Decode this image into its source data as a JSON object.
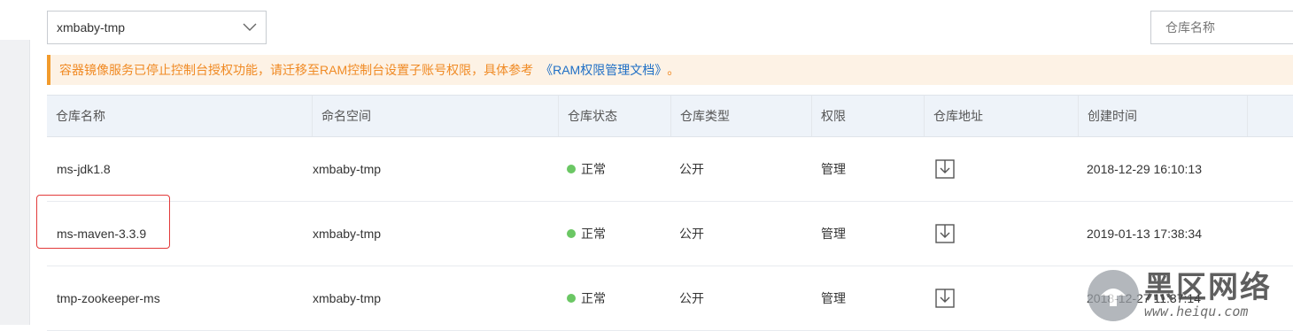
{
  "namespace_select": {
    "value": "xmbaby-tmp"
  },
  "search": {
    "placeholder": "仓库名称"
  },
  "notice": {
    "text": "容器镜像服务已停止控制台授权功能，请迁移至RAM控制台设置子账号权限，具体参考",
    "link": "《RAM权限管理文档》",
    "suffix": "。"
  },
  "table": {
    "headers": [
      "仓库名称",
      "命名空间",
      "仓库状态",
      "仓库类型",
      "权限",
      "仓库地址",
      "创建时间",
      ""
    ],
    "rows": [
      {
        "name": "ms-jdk1.8",
        "namespace": "xmbaby-tmp",
        "status": "正常",
        "type": "公开",
        "permission": "管理",
        "created": "2018-12-29 16:10:13"
      },
      {
        "name": "ms-maven-3.3.9",
        "namespace": "xmbaby-tmp",
        "status": "正常",
        "type": "公开",
        "permission": "管理",
        "created": "2019-01-13 17:38:34"
      },
      {
        "name": "tmp-zookeeper-ms",
        "namespace": "xmbaby-tmp",
        "status": "正常",
        "type": "公开",
        "permission": "管理",
        "created": "2018-12-27 11:37:14"
      }
    ]
  },
  "watermark": {
    "title": "黑区网络",
    "url": "www.heiqu.com"
  },
  "colors": {
    "status_ok": "#6bc764",
    "notice_text": "#f08a24",
    "link": "#1f6fc5",
    "highlight": "#e23a3a"
  }
}
